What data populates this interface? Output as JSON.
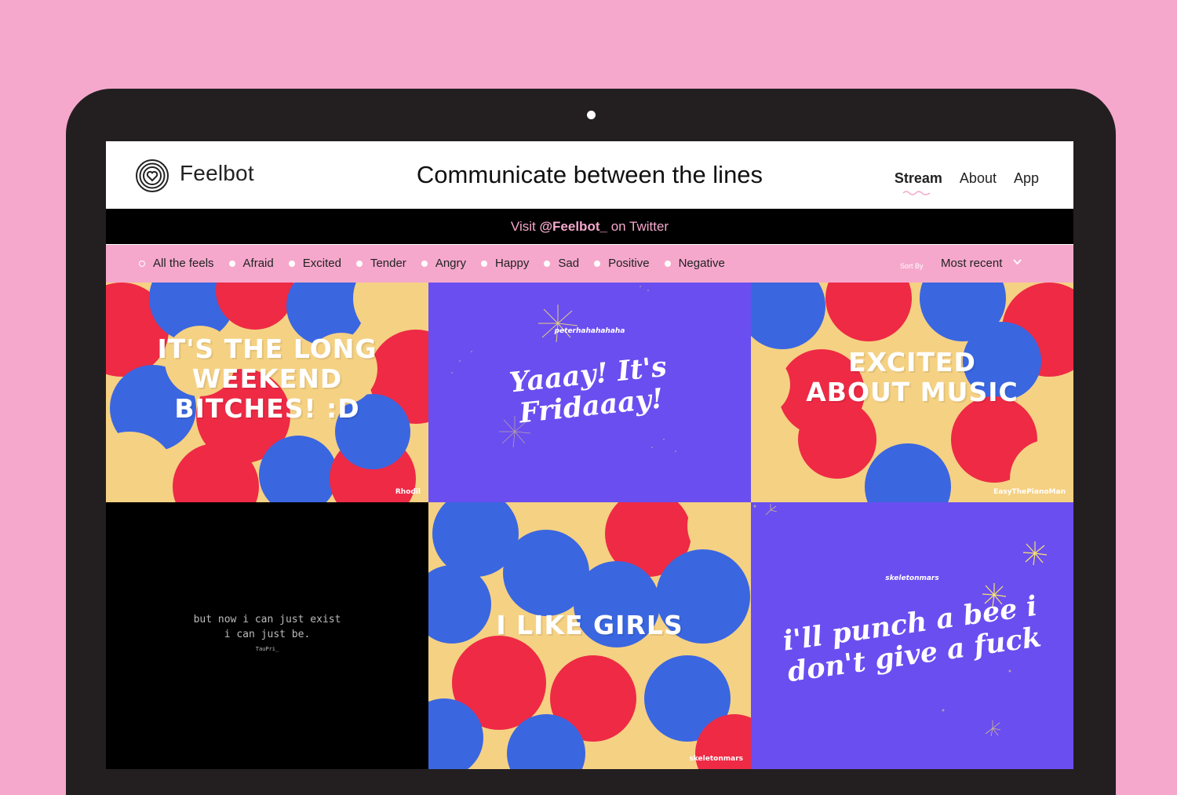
{
  "header": {
    "brand": "Feelbot",
    "tagline": "Communicate between the lines",
    "nav": [
      {
        "label": "Stream",
        "active": true
      },
      {
        "label": "About",
        "active": false
      },
      {
        "label": "App",
        "active": false
      }
    ]
  },
  "twitter_banner": {
    "prefix": "Visit",
    "handle": "@Feelbot_",
    "suffix": "on Twitter"
  },
  "filters": {
    "items": [
      "All the feels",
      "Afraid",
      "Excited",
      "Tender",
      "Angry",
      "Happy",
      "Sad",
      "Positive",
      "Negative"
    ],
    "selected": "All the feels",
    "sort_label": "Sort By",
    "sort_value": "Most recent"
  },
  "cards": [
    {
      "style": "bubbles",
      "lines": [
        "IT'S THE LONG",
        "WEEKEND",
        "BITCHES! :D"
      ],
      "handle": "Rhodil"
    },
    {
      "style": "fireworks",
      "lines": [
        "Yaaay! It's",
        "Fridaaay!"
      ],
      "handle": "peterhahahahaha"
    },
    {
      "style": "bubbles",
      "lines": [
        "EXCITED",
        "ABOUT MUSIC"
      ],
      "handle": "EasyThePianoMan"
    },
    {
      "style": "typewriter",
      "lines": [
        "but now i can just exist",
        "i can just be."
      ],
      "handle": "TauPri_"
    },
    {
      "style": "bubbles",
      "lines": [
        "I LIKE GIRLS"
      ],
      "handle": "skeletonmars"
    },
    {
      "style": "fireworks",
      "lines": [
        "i'll punch a bee i",
        "don't give a fuck"
      ],
      "handle": "skeletonmars"
    }
  ],
  "colors": {
    "pink": "#f5a8cc",
    "red": "#ee2a45",
    "blue": "#3a66e0",
    "sand": "#f5d183",
    "purple": "#6a4ef0",
    "yellow": "#f7e66a"
  }
}
